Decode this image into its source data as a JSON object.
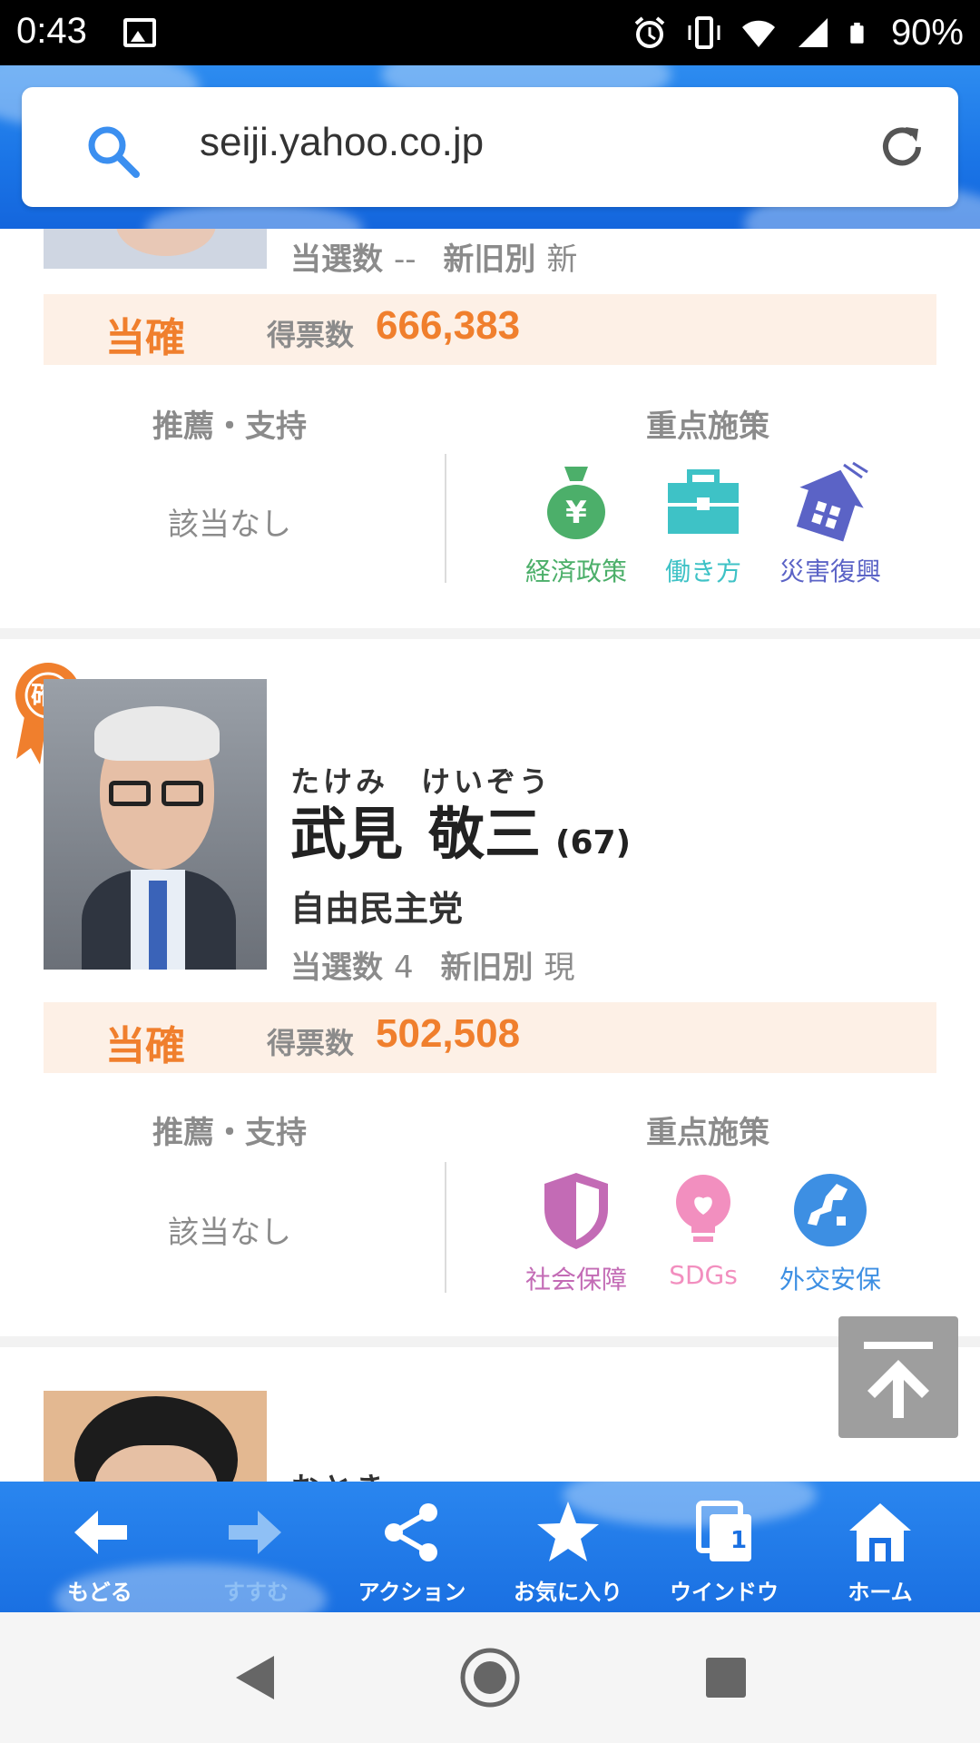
{
  "status_bar": {
    "time": "0:43",
    "battery": "90%"
  },
  "browser": {
    "url": "seiji.yahoo.co.jp"
  },
  "candidate_prev": {
    "wins_label": "当選数",
    "wins_value": "--",
    "status_label": "新旧別",
    "status_value": "新",
    "result": "当確",
    "votes_label": "得票数",
    "votes": "666,383",
    "support_title": "推薦・支持",
    "support_value": "該当なし",
    "policy_title": "重点施策",
    "policies": [
      {
        "label": "経済政策",
        "icon": "money-bag-icon",
        "color": "#4caf6a"
      },
      {
        "label": "働き方",
        "icon": "briefcase-icon",
        "color": "#3ec2c6"
      },
      {
        "label": "災害復興",
        "icon": "house-disaster-icon",
        "color": "#5b63c6"
      }
    ]
  },
  "candidate_main": {
    "badge": "確",
    "furigana_last": "たけみ",
    "furigana_first": "けいぞう",
    "name_last": "武見",
    "name_first": "敬三",
    "age": "(67)",
    "party": "自由民主党",
    "wins_label": "当選数",
    "wins_value": "4",
    "status_label": "新旧別",
    "status_value": "現",
    "result": "当確",
    "votes_label": "得票数",
    "votes": "502,508",
    "support_title": "推薦・支持",
    "support_value": "該当なし",
    "policy_title": "重点施策",
    "policies": [
      {
        "label": "社会保障",
        "icon": "shield-icon",
        "color": "#c36bb5"
      },
      {
        "label": "SDGs",
        "icon": "lightbulb-heart-icon",
        "color": "#f28fbf"
      },
      {
        "label": "外交安保",
        "icon": "globe-icon",
        "color": "#3d8fe3"
      }
    ]
  },
  "candidate_next": {
    "furigana_partial": "おとき..."
  },
  "toolbar": {
    "items": [
      {
        "label": "もどる",
        "icon": "arrow-left-icon"
      },
      {
        "label": "すすむ",
        "icon": "arrow-right-icon"
      },
      {
        "label": "アクション",
        "icon": "share-icon"
      },
      {
        "label": "お気に入り",
        "icon": "star-icon"
      },
      {
        "label": "ウインドウ",
        "icon": "window-icon",
        "badge": "1"
      },
      {
        "label": "ホーム",
        "icon": "home-icon"
      }
    ]
  },
  "colors": {
    "accent_orange": "#f07f2d",
    "toolbar_blue": "#1a70e2"
  }
}
